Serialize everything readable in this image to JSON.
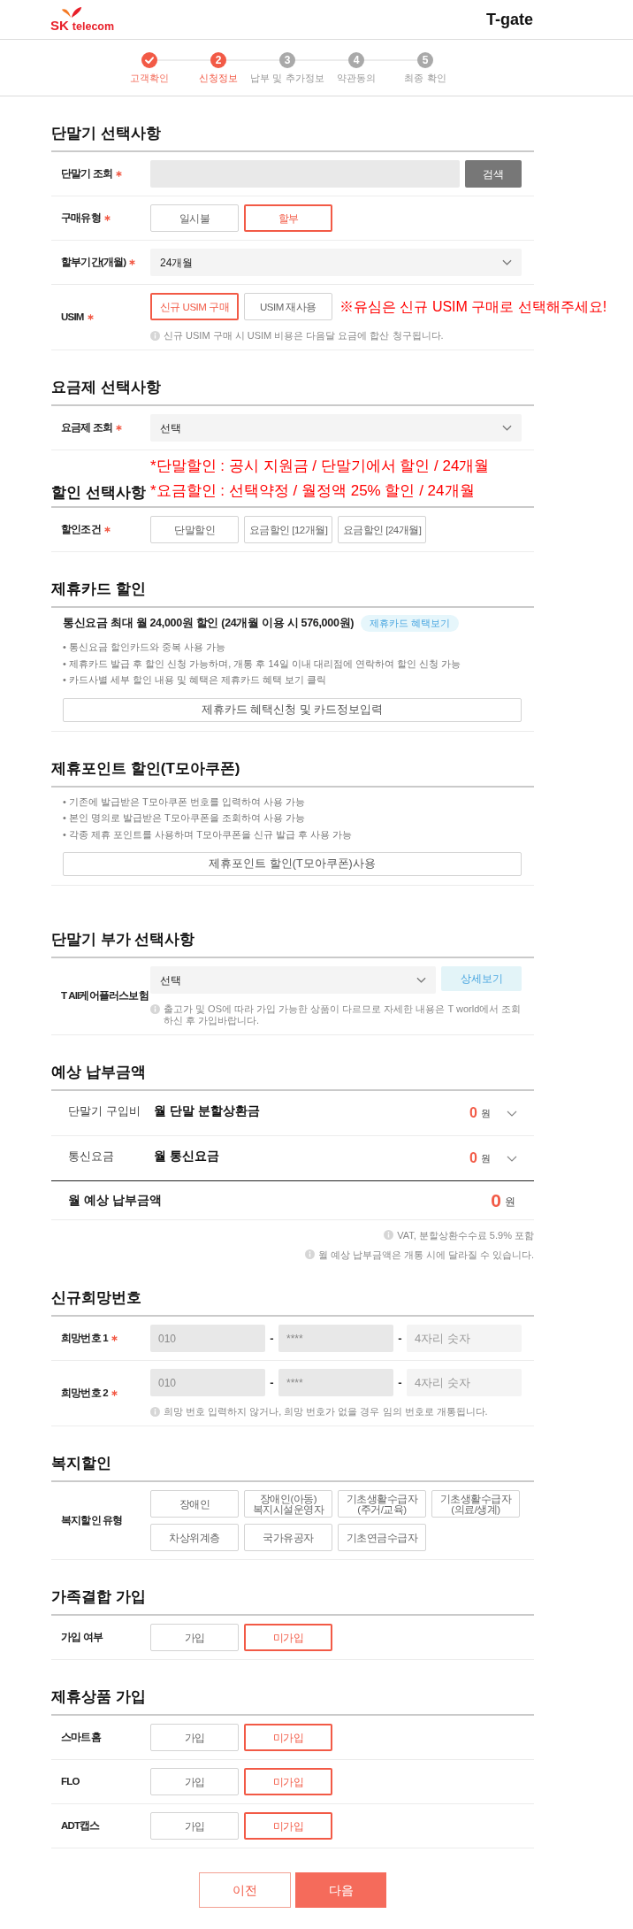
{
  "header": {
    "logo": {
      "brand": "SK",
      "name": "telecom"
    },
    "title": "T-gate"
  },
  "steps": [
    {
      "label": "고객확인",
      "done": true,
      "selected": false
    },
    {
      "number": "2",
      "label": "신청정보",
      "done": false,
      "selected": true
    },
    {
      "number": "3",
      "label": "납부 및 추가정보",
      "done": false,
      "selected": false
    },
    {
      "number": "4",
      "label": "약관동의",
      "done": false,
      "selected": false
    },
    {
      "number": "5",
      "label": "최종 확인",
      "done": false,
      "selected": false
    }
  ],
  "sections": [
    {
      "title": "단말기 선택사항",
      "rows": [
        {
          "kind": "search",
          "label": "단말기 조회",
          "required": true,
          "button": "검색"
        },
        {
          "kind": "options",
          "label": "구매유형",
          "required": true,
          "options": [
            {
              "label": "일시불",
              "selected": false
            },
            {
              "label": "할부",
              "selected": true
            }
          ]
        },
        {
          "kind": "select",
          "label": "할부기간(개월)",
          "required": true,
          "value": "24개월"
        },
        {
          "kind": "options",
          "label": "USIM",
          "required": true,
          "options": [
            {
              "label": "신규 USIM 구매",
              "selected": true
            },
            {
              "label": "USIM 재사용",
              "selected": false
            }
          ],
          "annotation": "※유심은 신규 USIM 구매로 선택해주세요!",
          "info": "신규 USIM 구매 시 USIM 비용은 다음달 요금에 합산 청구됩니다."
        }
      ]
    },
    {
      "title": "요금제 선택사항",
      "rows": [
        {
          "kind": "select",
          "label": "요금제 조회",
          "required": true,
          "value": "선택"
        }
      ]
    },
    {
      "title": "할인 선택사항",
      "annotations": [
        "*단말할인 : 공시 지원금 / 단말기에서 할인 / 24개월",
        "*요금할인 : 선택약정 / 월정액 25% 할인 / 24개월"
      ],
      "rows": [
        {
          "kind": "options",
          "label": "할인조건",
          "required": true,
          "options": [
            {
              "label": "단말할인",
              "selected": false
            },
            {
              "label": "요금할인 [12개월]",
              "selected": false
            },
            {
              "label": "요금할인 [24개월]",
              "selected": false
            }
          ]
        }
      ]
    },
    {
      "title": "제휴카드 할인",
      "rows": [
        {
          "kind": "notice",
          "headline": "통신요금 최대 월 24,000원 할인 (24개월 이용 시 576,000원)",
          "badge": "제휴카드 혜택보기",
          "bullets": [
            "• 통신요금 할인카드와 중복 사용 가능",
            "• 제휴카드 발급 후 할인 신청 가능하며, 개통 후 14일 이내 대리점에 연락하여 할인 신청 가능",
            "• 카드사별 세부 할인 내용 및 혜택은 제휴카드 혜택 보기 클릭"
          ],
          "button": "제휴카드 혜택신청 및 카드정보입력"
        }
      ]
    },
    {
      "title": "제휴포인트 할인(T모아쿠폰)",
      "rows": [
        {
          "kind": "notice",
          "bullets": [
            "• 기존에 발급받은 T모아쿠폰 번호를 입력하여 사용 가능",
            "• 본인 명의로 발급받은 T모아쿠폰을 조회하여 사용 가능",
            "• 각종 제휴 포인트를 사용하며 T모아쿠폰을 신규 발급 후 사용 가능"
          ],
          "button": "제휴포인트 할인(T모아쿠폰)사용"
        }
      ]
    },
    {
      "title": "단말기 부가 선택사항",
      "rows": [
        {
          "kind": "select",
          "label": "T All케어플러스보험",
          "required": false,
          "value": "선택",
          "button": "상세보기",
          "info": "출고가 및 OS에 따라 가입 가능한 상품이 다르므로 자세한 내용은 T world에서 조회하신 후 가입바랍니다."
        }
      ]
    },
    {
      "title": "예상 납부금액",
      "rows": [
        {
          "kind": "amount",
          "label": "단말기 구입비",
          "item": "월 단말 분할상환금",
          "amount": "0",
          "unit": "원",
          "expanded": false
        },
        {
          "kind": "amount",
          "label": "통신요금",
          "item": "월 통신요금",
          "amount": "0",
          "unit": "원",
          "expanded": false
        },
        {
          "kind": "total",
          "label": "월 예상 납부금액",
          "amount": "0",
          "unit": "원"
        }
      ],
      "notes": [
        "VAT, 분할상환수수료 5.9% 포함",
        "월 예상 납부금액은 개통 시에 달라질 수 있습니다."
      ]
    },
    {
      "title": "신규희망번호",
      "rows": [
        {
          "kind": "phone",
          "label": "희망번호 1",
          "required": true,
          "fields": [
            {
              "value": "010",
              "disabled": true
            },
            {
              "prefix": "-",
              "value": "****",
              "disabled": true
            },
            {
              "prefix": "-",
              "placeholder": "4자리 숫자",
              "disabled": false
            }
          ]
        },
        {
          "kind": "phone",
          "label": "희망번호 2",
          "required": true,
          "fields": [
            {
              "value": "010",
              "disabled": true
            },
            {
              "prefix": "-",
              "value": "****",
              "disabled": true
            },
            {
              "prefix": "-",
              "placeholder": "4자리 숫자",
              "disabled": false
            }
          ],
          "info": "희망 번호 입력하지 않거나, 희망 번호가 없을 경우 임의 번호로 개통됩니다."
        }
      ]
    },
    {
      "title": "복지할인",
      "rows": [
        {
          "kind": "options",
          "label": "복지할인 유형",
          "required": false,
          "options": [
            {
              "label": "장애인",
              "selected": false
            },
            {
              "label": "장애인(아동) 복지시설운영자",
              "selected": false
            },
            {
              "label": "기초생활수급자 (주거/교육)",
              "selected": false
            },
            {
              "label": "기초생활수급자 (의료/생계)",
              "selected": false
            },
            {
              "label": "차상위계층",
              "selected": false
            },
            {
              "label": "국가유공자",
              "selected": false
            },
            {
              "label": "기초연금수급자",
              "selected": false
            }
          ]
        }
      ]
    },
    {
      "title": "가족결합 가입",
      "rows": [
        {
          "kind": "options",
          "label": "가입 여부",
          "required": false,
          "options": [
            {
              "label": "가입",
              "selected": false
            },
            {
              "label": "미가입",
              "selected": true
            }
          ]
        }
      ]
    },
    {
      "title": "제휴상품 가입",
      "rows": [
        {
          "kind": "options",
          "label": "스마트홈",
          "required": false,
          "options": [
            {
              "label": "가입",
              "selected": false
            },
            {
              "label": "미가입",
              "selected": true
            }
          ]
        },
        {
          "kind": "options",
          "label": "FLO",
          "required": false,
          "options": [
            {
              "label": "가입",
              "selected": false
            },
            {
              "label": "미가입",
              "selected": true
            }
          ]
        },
        {
          "kind": "options",
          "label": "ADT캡스",
          "required": false,
          "options": [
            {
              "label": "가입",
              "selected": false
            },
            {
              "label": "미가입",
              "selected": true
            }
          ]
        }
      ]
    }
  ],
  "footer": {
    "buttons": [
      {
        "label": "이전",
        "kind": "secondary"
      },
      {
        "label": "다음",
        "kind": "primary"
      }
    ]
  }
}
